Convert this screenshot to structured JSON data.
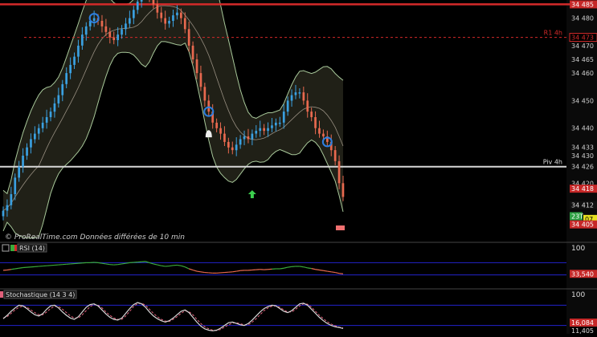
{
  "watermark": "© ProRealTime.com  Données différées de 10 min",
  "colors": {
    "up": "#3aa0e0",
    "down": "#e8694f",
    "band": "#a8c89a",
    "pivot": "#d8d8d8",
    "r1": "#d42a2a",
    "rsi": "#3aaa3a",
    "stoch": "#d8d8d8",
    "stochSignal": "#e0607a",
    "gridBlue": "#2222cc"
  },
  "chart_data": [
    {
      "type": "candlestick",
      "yticks": [
        34485,
        34480,
        34475,
        34470,
        34465,
        34460,
        34455,
        34450,
        34445,
        34440,
        34435,
        34430,
        34425,
        34420,
        34415,
        34410,
        34405
      ],
      "tick_labels": [
        "34 485",
        "34 480",
        "34 470",
        "34 465",
        "34 460",
        "34 450",
        "34 440",
        "34 433",
        "34 430",
        "34 426",
        "34 420",
        "34 418",
        "34 412",
        "34 405"
      ],
      "ylim": [
        34402,
        34486
      ],
      "levels": [
        {
          "name": "R1 4h",
          "value": 34473
        },
        {
          "name": "Piv 4h",
          "value": 34426
        }
      ],
      "top_level": {
        "label": "34 485",
        "value": 34485
      },
      "price_badges": [
        {
          "label": "34 473",
          "value": 34473,
          "type": "r1"
        },
        {
          "label": "34 418",
          "value": 34418,
          "type": "red"
        },
        {
          "label": "34 412",
          "value": 34412,
          "type": "plain"
        },
        {
          "label": "23T",
          "value": 34408,
          "type": "green"
        },
        {
          "label": "07",
          "value": 34407,
          "type": "yellow"
        },
        {
          "label": "34 405",
          "value": 34405,
          "type": "red"
        }
      ],
      "closes": [
        34410,
        34412,
        34416,
        34422,
        34426,
        34430,
        34433,
        34436,
        34438,
        34440,
        34442,
        34444,
        34446,
        34449,
        34452,
        34456,
        34460,
        34463,
        34466,
        34470,
        34474,
        34477,
        34479,
        34480,
        34479,
        34477,
        34475,
        34473,
        34472,
        34474,
        34476,
        34478,
        34480,
        34483,
        34486,
        34490,
        34493,
        34488,
        34485,
        34482,
        34480,
        34478,
        34479,
        34481,
        34482,
        34480,
        34476,
        34470,
        34465,
        34460,
        34455,
        34450,
        34446,
        34442,
        34440,
        34438,
        34435,
        34433,
        34432,
        34434,
        34436,
        34437,
        34436,
        34438,
        34439,
        34440,
        34439,
        34440,
        34441,
        34442,
        34442,
        34446,
        34450,
        34452,
        34453,
        34453,
        34450,
        34446,
        34444,
        34440,
        34438,
        34437,
        34435,
        34432,
        34428,
        34420,
        34415
      ]
    },
    {
      "type": "line",
      "title": "RSI (14)",
      "ylim": [
        0,
        100
      ],
      "tick_labels": [
        "100",
        "33,540"
      ],
      "last_value": 33.54,
      "values": [
        45,
        46,
        48,
        50,
        52,
        54,
        55,
        56,
        57,
        58,
        59,
        60,
        61,
        62,
        63,
        64,
        65,
        66,
        67,
        68,
        69,
        70,
        70,
        71,
        70,
        68,
        66,
        64,
        63,
        64,
        66,
        68,
        70,
        71,
        72,
        73,
        74,
        70,
        66,
        63,
        60,
        58,
        59,
        61,
        62,
        60,
        56,
        50,
        46,
        42,
        40,
        38,
        37,
        36,
        36,
        37,
        38,
        39,
        40,
        42,
        44,
        45,
        45,
        46,
        47,
        48,
        47,
        48,
        49,
        50,
        50,
        52,
        55,
        57,
        58,
        58,
        56,
        53,
        51,
        48,
        46,
        44,
        42,
        40,
        38,
        35,
        33.5
      ]
    },
    {
      "type": "line",
      "title": "Stochastique (14 3 4)",
      "ylim": [
        0,
        100
      ],
      "tick_labels": [
        "100",
        "16,084",
        "11,405"
      ],
      "values": [
        40,
        50,
        62,
        72,
        80,
        78,
        70,
        60,
        52,
        48,
        55,
        68,
        78,
        80,
        72,
        60,
        50,
        42,
        38,
        46,
        60,
        74,
        82,
        84,
        78,
        66,
        54,
        44,
        38,
        36,
        42,
        56,
        70,
        82,
        88,
        84,
        74,
        60,
        48,
        40,
        34,
        30,
        34,
        42,
        52,
        62,
        66,
        58,
        44,
        30,
        18,
        10,
        6,
        4,
        6,
        12,
        20,
        28,
        30,
        26,
        22,
        20,
        26,
        36,
        48,
        60,
        70,
        76,
        80,
        78,
        70,
        62,
        58,
        64,
        74,
        84,
        86,
        80,
        68,
        56,
        44,
        34,
        26,
        20,
        16,
        14,
        11
      ],
      "signal": [
        42,
        46,
        56,
        66,
        74,
        77,
        74,
        66,
        58,
        52,
        52,
        60,
        70,
        77,
        76,
        68,
        58,
        48,
        42,
        42,
        52,
        64,
        76,
        82,
        80,
        72,
        60,
        50,
        42,
        38,
        38,
        48,
        62,
        76,
        85,
        86,
        80,
        68,
        56,
        46,
        38,
        33,
        32,
        38,
        46,
        56,
        63,
        61,
        52,
        38,
        26,
        16,
        10,
        6,
        5,
        8,
        15,
        22,
        27,
        28,
        25,
        22,
        22,
        30,
        40,
        52,
        64,
        72,
        77,
        78,
        74,
        66,
        60,
        60,
        68,
        78,
        84,
        83,
        74,
        62,
        50,
        40,
        31,
        24,
        19,
        15,
        13
      ]
    }
  ]
}
